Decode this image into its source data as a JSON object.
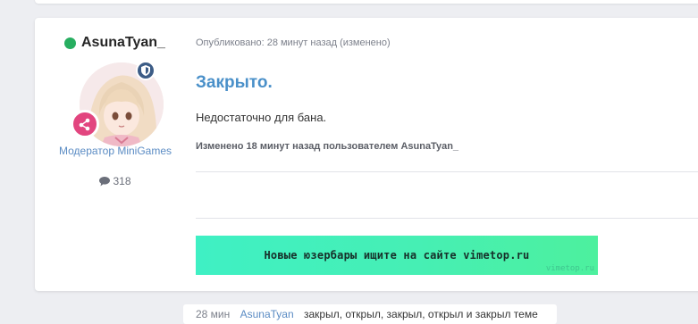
{
  "author": {
    "name": "AsunaTyan_",
    "status_color": "#27ae60",
    "title": "Модератор MiniGames",
    "post_count": "318",
    "avatar_icon": "anime-avatar",
    "badges": [
      "shield-icon",
      "share-nodes-icon"
    ]
  },
  "post": {
    "meta": "Опубликовано: 28 минут назад (изменено)",
    "heading": "Закрыто.",
    "body": "Недостаточно для бана.",
    "edit_note": "Изменено 18 минут назад пользователем AsunaTyan_"
  },
  "banner": {
    "text": "Новые юзербары ищите на сайте vimetop.ru",
    "watermark": "vimetop.ru",
    "color_start": "#3ff0c4",
    "color_end": "#4df09e"
  },
  "activity": {
    "time": "28 мин",
    "user": "AsunaTyan",
    "action": "закрыл, открыл, закрыл, открыл и закрыл теме"
  },
  "colors": {
    "accent": "#4a90c9",
    "link": "#5b8cc4",
    "group_badge": "#e2457f",
    "shield_badge": "#3c5c86"
  }
}
